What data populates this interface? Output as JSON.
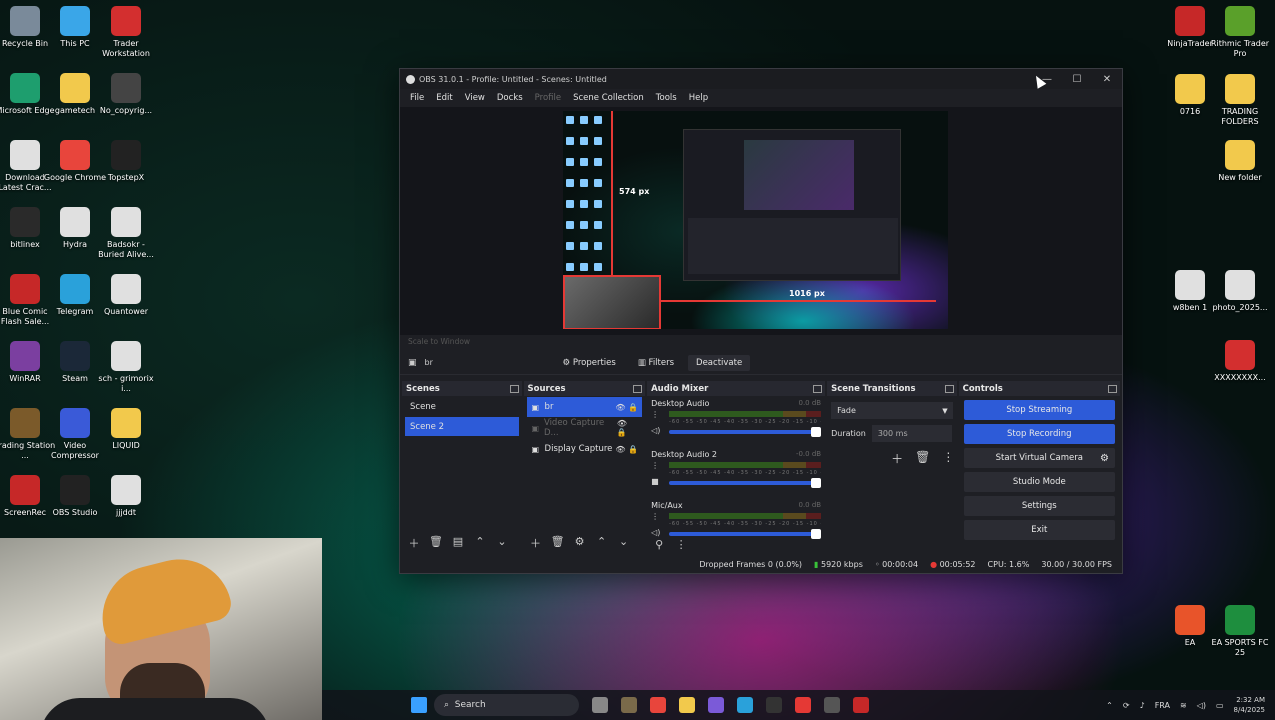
{
  "desktop": {
    "left_icons": [
      {
        "label": "Recycle Bin",
        "icon": "recycle-bin-icon",
        "color": "#7a8a9a"
      },
      {
        "label": "This PC",
        "icon": "monitor-icon",
        "color": "#3aa6e8"
      },
      {
        "label": "Trader Workstation",
        "icon": "tws-icon",
        "color": "#d32f2f"
      },
      {
        "label": "Microsoft Edge",
        "icon": "edge-icon",
        "color": "#1e9e6e"
      },
      {
        "label": "gametech",
        "icon": "folder-icon",
        "color": "#f2c94c"
      },
      {
        "label": "No_copyrig...",
        "icon": "file-icon",
        "color": "#444"
      },
      {
        "label": "Download Latest Crac...",
        "icon": "pdf-icon",
        "color": "#e0e0e0"
      },
      {
        "label": "Google Chrome",
        "icon": "chrome-icon",
        "color": "#e8453c"
      },
      {
        "label": "TopstepX",
        "icon": "topstepx-icon",
        "color": "#222"
      },
      {
        "label": "bitlinex",
        "icon": "bitlinex-icon",
        "color": "#2a2a2a"
      },
      {
        "label": "Hydra",
        "icon": "video-file-icon",
        "color": "#e0e0e0"
      },
      {
        "label": "Badsokr - Buried Alive...",
        "icon": "video-file-icon",
        "color": "#e0e0e0"
      },
      {
        "label": "Blue Comic Flash Sale...",
        "icon": "red-app-icon",
        "color": "#c62828"
      },
      {
        "label": "Telegram",
        "icon": "telegram-icon",
        "color": "#2aa1da"
      },
      {
        "label": "Quantower",
        "icon": "file-icon",
        "color": "#e0e0e0"
      },
      {
        "label": "WinRAR",
        "icon": "winrar-icon",
        "color": "#7b3fa0"
      },
      {
        "label": "Steam",
        "icon": "steam-icon",
        "color": "#1b2838"
      },
      {
        "label": "sch - grimorix i...",
        "icon": "video-file-icon",
        "color": "#e0e0e0"
      },
      {
        "label": "Trading Station ...",
        "icon": "trading-station-icon",
        "color": "#7b5a2a"
      },
      {
        "label": "Video Compressor",
        "icon": "video-compressor-icon",
        "color": "#3a5ad8"
      },
      {
        "label": "LIQUID",
        "icon": "folder-icon",
        "color": "#f2c94c"
      },
      {
        "label": "ScreenRec",
        "icon": "screenrec-icon",
        "color": "#c62828"
      },
      {
        "label": "OBS Studio",
        "icon": "obs-icon",
        "color": "#222"
      },
      {
        "label": "jjjddt",
        "icon": "image-file-icon",
        "color": "#e0e0e0"
      }
    ],
    "right_icons": [
      {
        "label": "NinjaTrader",
        "icon": "ninjatrader-icon",
        "color": "#c62828"
      },
      {
        "label": "Rithmic Trader Pro",
        "icon": "rithmic-icon",
        "color": "#5aa02a"
      },
      {
        "label": "0716",
        "icon": "folder-icon",
        "color": "#f2c94c"
      },
      {
        "label": "TRADING FOLDERS",
        "icon": "folder-icon",
        "color": "#f2c94c"
      },
      {
        "label": "New folder",
        "icon": "folder-icon",
        "color": "#f2c94c"
      },
      {
        "label": "w8ben 1",
        "icon": "file-icon",
        "color": "#e0e0e0"
      },
      {
        "label": "photo_2025...",
        "icon": "file-icon",
        "color": "#e0e0e0"
      },
      {
        "label": "XXXXXXXX...",
        "icon": "pdf-icon",
        "color": "#d32f2f"
      },
      {
        "label": "EA",
        "icon": "ea-icon",
        "color": "#e8542a"
      },
      {
        "label": "EA SPORTS FC 25",
        "icon": "fc25-icon",
        "color": "#1e8e3e"
      }
    ]
  },
  "obs": {
    "title": "OBS 31.0.1 - Profile: Untitled - Scenes: Untitled",
    "menu": [
      "File",
      "Edit",
      "View",
      "Docks",
      "Profile",
      "Scene Collection",
      "Tools",
      "Help"
    ],
    "preview": {
      "height_label": "574 px",
      "width_label": "1016 px",
      "scale_label": "Scale to Window"
    },
    "source_toolbar": {
      "selected_source": "br",
      "properties": "Properties",
      "filters": "Filters",
      "deactivate": "Deactivate"
    },
    "scenes": {
      "title": "Scenes",
      "items": [
        "Scene",
        "Scene 2"
      ],
      "selected_index": 1
    },
    "sources": {
      "title": "Sources",
      "items": [
        {
          "name": "br",
          "selected": true,
          "visible": true
        },
        {
          "name": "Video Capture D...",
          "selected": false,
          "visible": false
        },
        {
          "name": "Display Capture",
          "selected": false,
          "visible": true
        }
      ]
    },
    "audio_mixer": {
      "title": "Audio Mixer",
      "channels": [
        {
          "name": "Desktop Audio",
          "db": "0.0 dB"
        },
        {
          "name": "Desktop Audio 2",
          "db": "-0.0 dB"
        },
        {
          "name": "Mic/Aux",
          "db": "0.0 dB"
        }
      ],
      "ticks": "-60 -55 -50 -45 -40 -35 -30 -25 -20 -15 -10 -5 0"
    },
    "transitions": {
      "title": "Scene Transitions",
      "type": "Fade",
      "duration_label": "Duration",
      "duration_value": "300 ms"
    },
    "controls": {
      "title": "Controls",
      "buttons": [
        "Stop Streaming",
        "Stop Recording",
        "Start Virtual Camera",
        "Studio Mode",
        "Settings",
        "Exit"
      ]
    },
    "status": {
      "dropped": "Dropped Frames 0 (0.0%)",
      "bitrate": "5920 kbps",
      "stream_time": "00:00:04",
      "rec_time": "00:05:52",
      "cpu": "CPU: 1.6%",
      "fps": "30.00 / 30.00 FPS"
    }
  },
  "taskbar": {
    "search": "Search",
    "lang": "FRA",
    "time": "2:32 AM",
    "date": "8/4/2025"
  }
}
